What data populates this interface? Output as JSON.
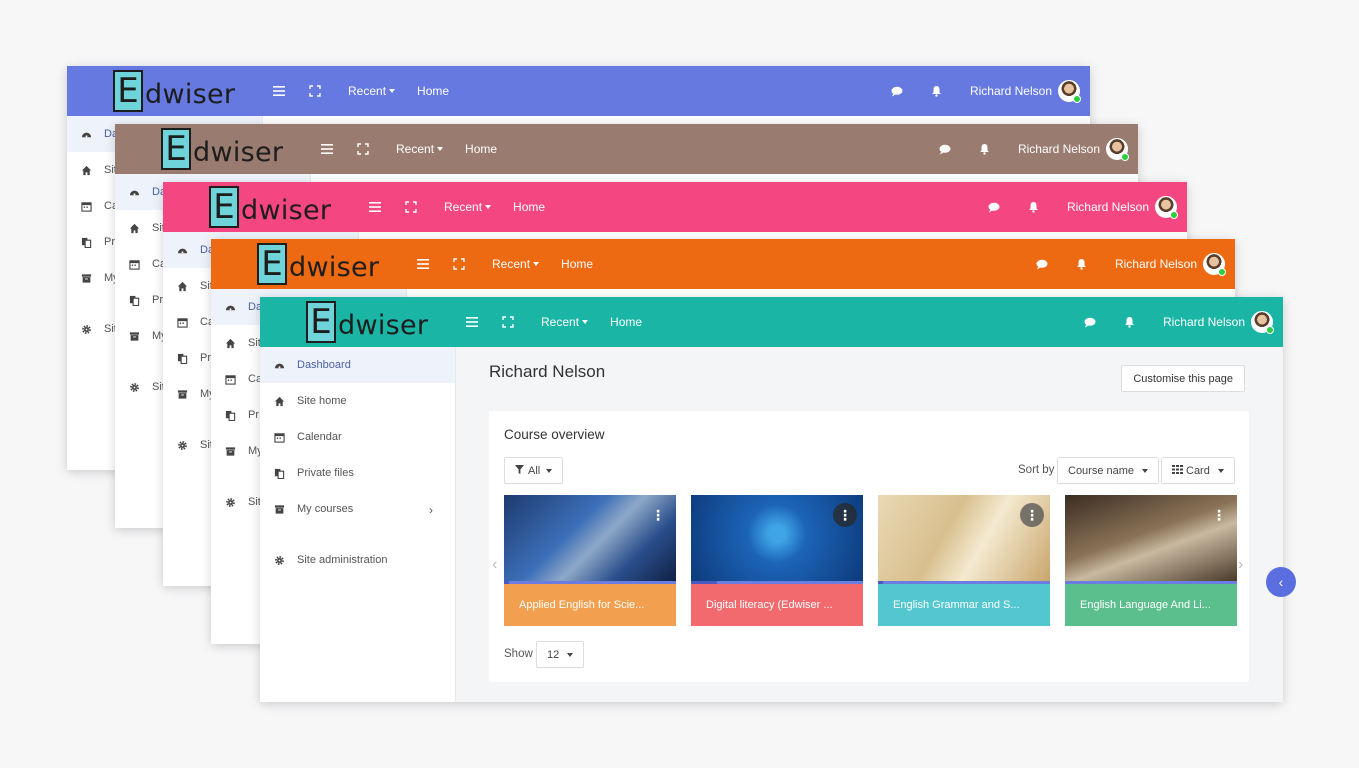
{
  "brand": {
    "logo_letter": "E",
    "logo_text": "dwiser"
  },
  "navbar": {
    "recent": "Recent",
    "home": "Home",
    "user_name": "Richard Nelson"
  },
  "theme_colors": [
    "#6679e0",
    "#9a7b70",
    "#f44680",
    "#ee6a12",
    "#1bb5a6"
  ],
  "sidebar": {
    "items": [
      {
        "label": "Dashboard",
        "icon": "dashboard-icon"
      },
      {
        "label": "Site home",
        "icon": "home-icon"
      },
      {
        "label": "Calendar",
        "icon": "calendar-icon"
      },
      {
        "label": "Private files",
        "icon": "files-icon"
      },
      {
        "label": "My courses",
        "icon": "archive-icon"
      },
      {
        "label": "Site administration",
        "icon": "gear-icon"
      }
    ],
    "back_labels": [
      "Da",
      "Sit",
      "Ca",
      "Pr",
      "My",
      "Sit"
    ]
  },
  "main": {
    "page_title": "Richard Nelson",
    "customise_label": "Customise this page",
    "panel_title": "Course overview",
    "filter_label": "All",
    "sort_label": "Sort by",
    "sort_value": "Course name",
    "view_value": "Card",
    "show_label": "Show",
    "show_value": "12",
    "courses": [
      {
        "title": "Applied English for Scie...",
        "color": "#f2a04f",
        "progress": 0.03
      },
      {
        "title": "Digital literacy (Edwiser ...",
        "color": "#f26a6e",
        "progress": 0.15
      },
      {
        "title": "English Grammar and S...",
        "color": "#53c7d0",
        "progress": 0.03
      },
      {
        "title": "English Language And Li...",
        "color": "#5bbf8d",
        "progress": 0.0
      }
    ]
  }
}
